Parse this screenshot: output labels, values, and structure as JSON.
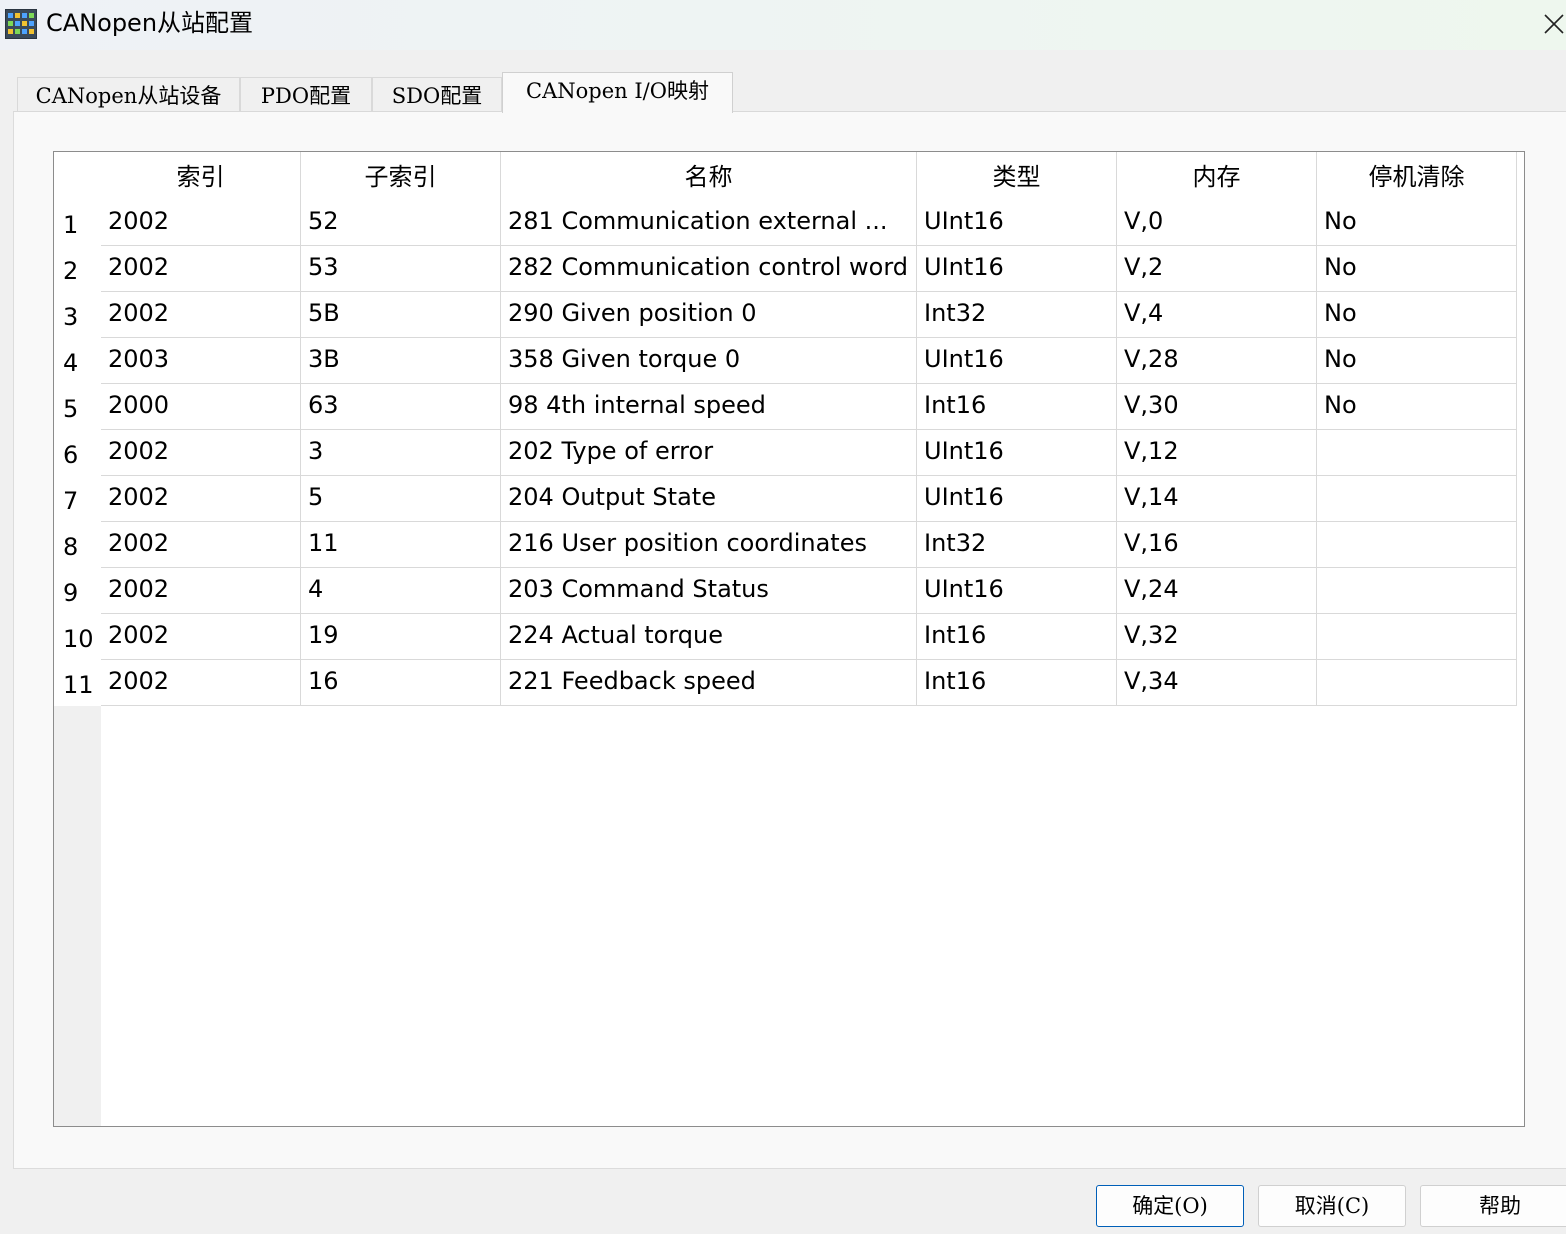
{
  "window": {
    "title": "CANopen从站配置"
  },
  "tabs": [
    {
      "label": "CANopen从站设备"
    },
    {
      "label": "PDO配置"
    },
    {
      "label": "SDO配置"
    },
    {
      "label": "CANopen I/O映射"
    }
  ],
  "active_tab": 3,
  "table": {
    "columns": [
      "索引",
      "子索引",
      "名称",
      "类型",
      "内存",
      "停机清除"
    ],
    "rows": [
      {
        "num": "1",
        "cells": [
          "2002",
          "52",
          "281 Communication external ...",
          "UInt16",
          "V,0",
          "No"
        ]
      },
      {
        "num": "2",
        "cells": [
          "2002",
          "53",
          "282 Communication control word",
          "UInt16",
          "V,2",
          "No"
        ]
      },
      {
        "num": "3",
        "cells": [
          "2002",
          "5B",
          "290 Given position 0",
          "Int32",
          "V,4",
          "No"
        ]
      },
      {
        "num": "4",
        "cells": [
          "2003",
          "3B",
          "358 Given torque 0",
          "UInt16",
          "V,28",
          "No"
        ]
      },
      {
        "num": "5",
        "cells": [
          "2000",
          "63",
          "98 4th internal speed",
          "Int16",
          "V,30",
          "No"
        ]
      },
      {
        "num": "6",
        "cells": [
          "2002",
          "3",
          "202 Type of error",
          "UInt16",
          "V,12",
          ""
        ]
      },
      {
        "num": "7",
        "cells": [
          "2002",
          "5",
          "204 Output State",
          "UInt16",
          "V,14",
          ""
        ]
      },
      {
        "num": "8",
        "cells": [
          "2002",
          "11",
          "216 User position coordinates",
          "Int32",
          "V,16",
          ""
        ]
      },
      {
        "num": "9",
        "cells": [
          "2002",
          "4",
          "203 Command Status",
          "UInt16",
          "V,24",
          ""
        ]
      },
      {
        "num": "10",
        "cells": [
          "2002",
          "19",
          "224 Actual torque",
          "Int16",
          "V,32",
          ""
        ]
      },
      {
        "num": "11",
        "cells": [
          "2002",
          "16",
          "221 Feedback speed",
          "Int16",
          "V,34",
          ""
        ]
      }
    ]
  },
  "buttons": {
    "ok": "确定(O)",
    "cancel": "取消(C)",
    "help": "帮助"
  }
}
